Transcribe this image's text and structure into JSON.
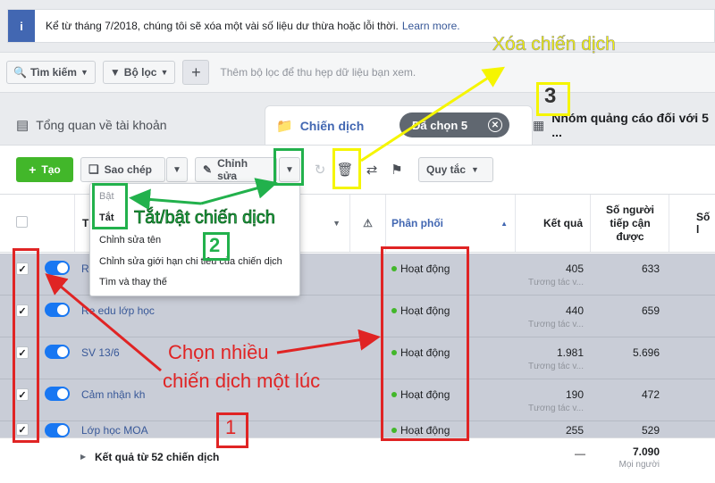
{
  "notice": {
    "text": "Kể từ tháng 7/2018, chúng tôi sẽ xóa một vài số liệu dư thừa hoặc lỗi thời.",
    "link": "Learn more."
  },
  "filterbar": {
    "search_label": "Tìm kiếm",
    "filter_label": "Bộ lọc",
    "placeholder": "Thêm bộ lọc để thu hẹp dữ liệu bạn xem."
  },
  "tabs": {
    "overview": "Tổng quan về tài khoản",
    "campaigns": "Chiến dịch",
    "selected": "Đã chọn 5",
    "adsets": "Nhóm quảng cáo đối với 5 ..."
  },
  "toolbar": {
    "create": "Tạo",
    "copy": "Sao chép",
    "edit": "Chỉnh sửa",
    "rules": "Quy tắc"
  },
  "table": {
    "headers": {
      "name": "T",
      "delivery": "Phân phối",
      "results": "Kết quả",
      "reach": "Số người tiếp cận được",
      "more": "Số l"
    },
    "rows": [
      {
        "name": "Ra",
        "status": "Hoạt động",
        "results": "405",
        "results_sub": "Tương tác v...",
        "reach": "633"
      },
      {
        "name": "Re edu lớp học",
        "status": "Hoạt động",
        "results": "440",
        "results_sub": "Tương tác v...",
        "reach": "659"
      },
      {
        "name": "SV 13/6",
        "status": "Hoạt động",
        "results": "1.981",
        "results_sub": "Tương tác v...",
        "reach": "5.696"
      },
      {
        "name": "Cảm nhận kh",
        "status": "Hoạt động",
        "results": "190",
        "results_sub": "Tương tác v...",
        "reach": "472"
      },
      {
        "name": "Lớp học MOA",
        "status": "Hoạt động",
        "results": "255",
        "results_sub": "",
        "reach": "529"
      }
    ],
    "footer": {
      "label": "Kết quả từ 52 chiến dịch",
      "results": "—",
      "reach": "7.090",
      "reach_sub": "Mọi người"
    }
  },
  "menu": {
    "items": [
      "Bật",
      "Tắt",
      "Chỉnh sửa tên",
      "Chỉnh sửa giới hạn chi tiêu của chiến dịch",
      "Tìm và thay thế"
    ]
  },
  "annotations": {
    "delete_campaign": "Xóa chiến dịch",
    "num3": "3",
    "toggle_campaign": "Tắt/bật chiến dịch",
    "num2": "2",
    "select_multiple_line1": "Chọn nhiều",
    "select_multiple_line2": "chiến dịch một lúc",
    "num1": "1"
  },
  "colors": {
    "accent": "#4267b2",
    "green": "#42b72a",
    "annotation_red": "#e02424",
    "annotation_green": "#22b14c",
    "annotation_yellow": "#f5f500"
  }
}
